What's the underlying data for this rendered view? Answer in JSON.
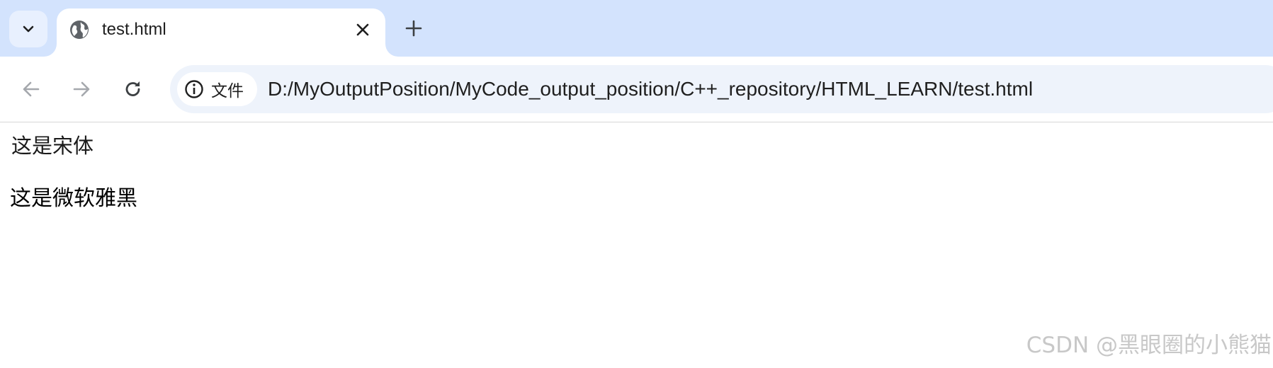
{
  "tab": {
    "title": "test.html",
    "favicon": "globe-icon"
  },
  "toolbar": {
    "back_icon": "arrow-left-icon",
    "forward_icon": "arrow-right-icon",
    "reload_icon": "reload-icon"
  },
  "omnibox": {
    "chip_icon": "info-icon",
    "chip_label": "文件",
    "url": "D:/MyOutputPosition/MyCode_output_position/C++_repository/HTML_LEARN/test.html"
  },
  "page": {
    "line_songti": "这是宋体",
    "line_yahei": "这是微软雅黑"
  },
  "watermark": "CSDN @黑眼圈的小熊猫",
  "colors": {
    "tabstrip_bg": "#d3e3fd",
    "omnibox_bg": "#eef3fb",
    "icon_dark": "#3c4043",
    "icon_disabled": "#a5a8ad",
    "watermark": "#c8c8c8"
  }
}
